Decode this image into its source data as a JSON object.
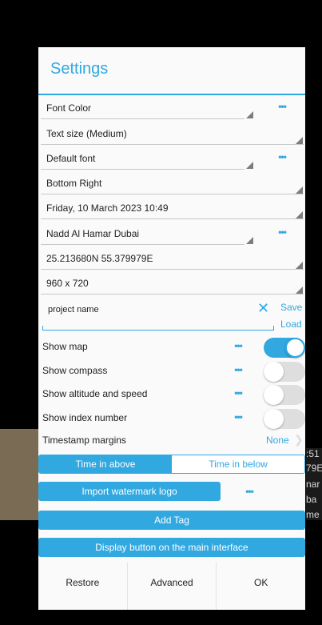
{
  "background": {
    "peek_text": [
      ":51",
      "79E",
      "nar",
      "ba",
      "me"
    ]
  },
  "dialog": {
    "title": "Settings",
    "rows": [
      {
        "label": "Font Color",
        "has_more": true
      },
      {
        "label": "Text size (Medium)",
        "has_more": false
      },
      {
        "label": "Default font",
        "has_more": true
      },
      {
        "label": "Bottom Right",
        "has_more": false
      },
      {
        "label": "Friday, 10 March 2023 10:49",
        "has_more": false
      },
      {
        "label": "Nadd Al Hamar Dubai",
        "has_more": true
      },
      {
        "label": "25.213680N 55.379979E",
        "has_more": false
      },
      {
        "label": "960 x 720",
        "has_more": false
      }
    ],
    "more_glyph": "•••",
    "project": {
      "value": "project name",
      "clear_glyph": "✕",
      "save_label": "Save",
      "load_label": "Load"
    },
    "toggles": [
      {
        "label": "Show map",
        "on": true
      },
      {
        "label": "Show compass",
        "on": false
      },
      {
        "label": "Show altitude and speed",
        "on": false
      },
      {
        "label": "Show index number",
        "on": false
      }
    ],
    "margins": {
      "label": "Timestamp margins",
      "value": "None",
      "chevron": "❯"
    },
    "segment": {
      "options": [
        "Time in above",
        "Time in below"
      ],
      "selected_index": 0
    },
    "import_logo_label": "Import watermark logo",
    "add_tag_label": "Add Tag",
    "display_button_label": "Display button on the main interface",
    "footer": {
      "restore": "Restore",
      "advanced": "Advanced",
      "ok": "OK"
    },
    "accent_color": "#31a8e0"
  }
}
